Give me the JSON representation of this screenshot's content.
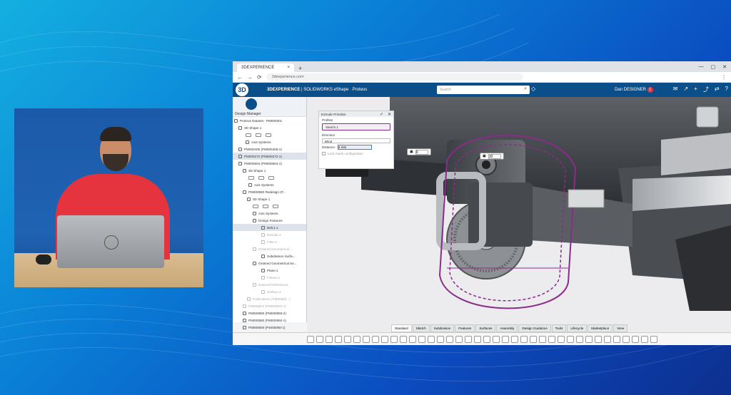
{
  "browser": {
    "tab_title": "3DEXPERIENCE",
    "tab_close": "×",
    "new_tab": "+",
    "window_controls": [
      "—",
      "▢",
      "✕"
    ],
    "url": "3dexperience.com",
    "nav_icons": [
      "←",
      "→",
      "⟳"
    ],
    "menu_icon": "⋮"
  },
  "app": {
    "compass_label": "3D",
    "brand_strong": "3DEXPERIENCE",
    "brand_rest": " | SOLIDWORKS eShape · Proteus",
    "search_placeholder": "Search",
    "user_name": "Dan DESIGNER",
    "notification_count": "1",
    "right_icons": [
      "✉",
      "↗",
      "+",
      "⤴",
      "⇄",
      "?"
    ]
  },
  "tree": {
    "title": "Design Manager",
    "rows": [
      {
        "label": "Proteus Dataset - PM000001",
        "indent": 2,
        "dim": false
      },
      {
        "label": "3D Shape 1",
        "indent": 8,
        "dim": false
      },
      {
        "label": "",
        "indent": 18,
        "dim": false,
        "tools": true
      },
      {
        "label": "Axis Systems",
        "indent": 18,
        "dim": false
      },
      {
        "label": "PM000405 (PM000405-1)",
        "indent": 8,
        "dim": false
      },
      {
        "label": "PM000272 (PM000272-1)",
        "indent": 8,
        "dim": false,
        "sel": true
      },
      {
        "label": "PM000604 (PM000604-1)",
        "indent": 8,
        "dim": false
      },
      {
        "label": "3D Shape 1",
        "indent": 14,
        "dim": false
      },
      {
        "label": "",
        "indent": 22,
        "dim": false,
        "tools": true
      },
      {
        "label": "Axis Systems",
        "indent": 22,
        "dim": false
      },
      {
        "label": "PM000950 Redesign (P...",
        "indent": 14,
        "dim": false
      },
      {
        "label": "3D Shape 1",
        "indent": 20,
        "dim": false
      },
      {
        "label": "",
        "indent": 28,
        "dim": false,
        "tools": true
      },
      {
        "label": "Axis Systems",
        "indent": 28,
        "dim": false
      },
      {
        "label": "Design Features",
        "indent": 28,
        "dim": false
      },
      {
        "label": "Belt.1.1",
        "indent": 40,
        "dim": false,
        "sel": true
      },
      {
        "label": "Extrude.2",
        "indent": 40,
        "dim": true
      },
      {
        "label": "Fillet.3",
        "indent": 40,
        "dim": true
      },
      {
        "label": "Ordered Geometrical ...",
        "indent": 28,
        "dim": true
      },
      {
        "label": "Subdivision Surfa...",
        "indent": 40,
        "dim": false
      },
      {
        "label": "Ordered Geometrical Se...",
        "indent": 28,
        "dim": false
      },
      {
        "label": "Plane.1",
        "indent": 40,
        "dim": false
      },
      {
        "label": "Fixture.2",
        "indent": 40,
        "dim": true
      },
      {
        "label": "External References",
        "indent": 28,
        "dim": true
      },
      {
        "label": "Surface.2",
        "indent": 40,
        "dim": true
      },
      {
        "label": "Publications (PM00000...)",
        "indent": 20,
        "dim": true
      },
      {
        "label": "PM000972 (PM000972-1)",
        "indent": 14,
        "dim": true
      },
      {
        "label": "PM000950 (PM000950-2)",
        "indent": 14,
        "dim": false
      },
      {
        "label": "PM000950 (PM000950-1)",
        "indent": 14,
        "dim": false
      },
      {
        "label": "PM000500 (P4000050-1)",
        "indent": 14,
        "dim": false
      }
    ]
  },
  "panel": {
    "title": "Extrude Primitive",
    "ok_icon": "✓",
    "close_icon": "✕",
    "profiles_label": "Profiles",
    "profile_value": "Sketch.1",
    "direction_label": "Direction",
    "direction_value": "Blind",
    "distance_label": "Distance",
    "distance_value": "2 mm",
    "lock_label": "Lock mesh configuration"
  },
  "viewport": {
    "field_a": "0",
    "field_b": "10"
  },
  "bottom_tabs": [
    "Standard",
    "Sketch",
    "Subdivision",
    "Features",
    "Surfaces",
    "Assembly",
    "Design Guidance",
    "Tools",
    "Lifecycle",
    "Marketplace",
    "View"
  ],
  "active_bottom_tab": "Standard",
  "colors": {
    "accent": "#0b4f8a",
    "selection_purple": "#8a2c8a",
    "presenter_shirt": "#e5343d"
  }
}
